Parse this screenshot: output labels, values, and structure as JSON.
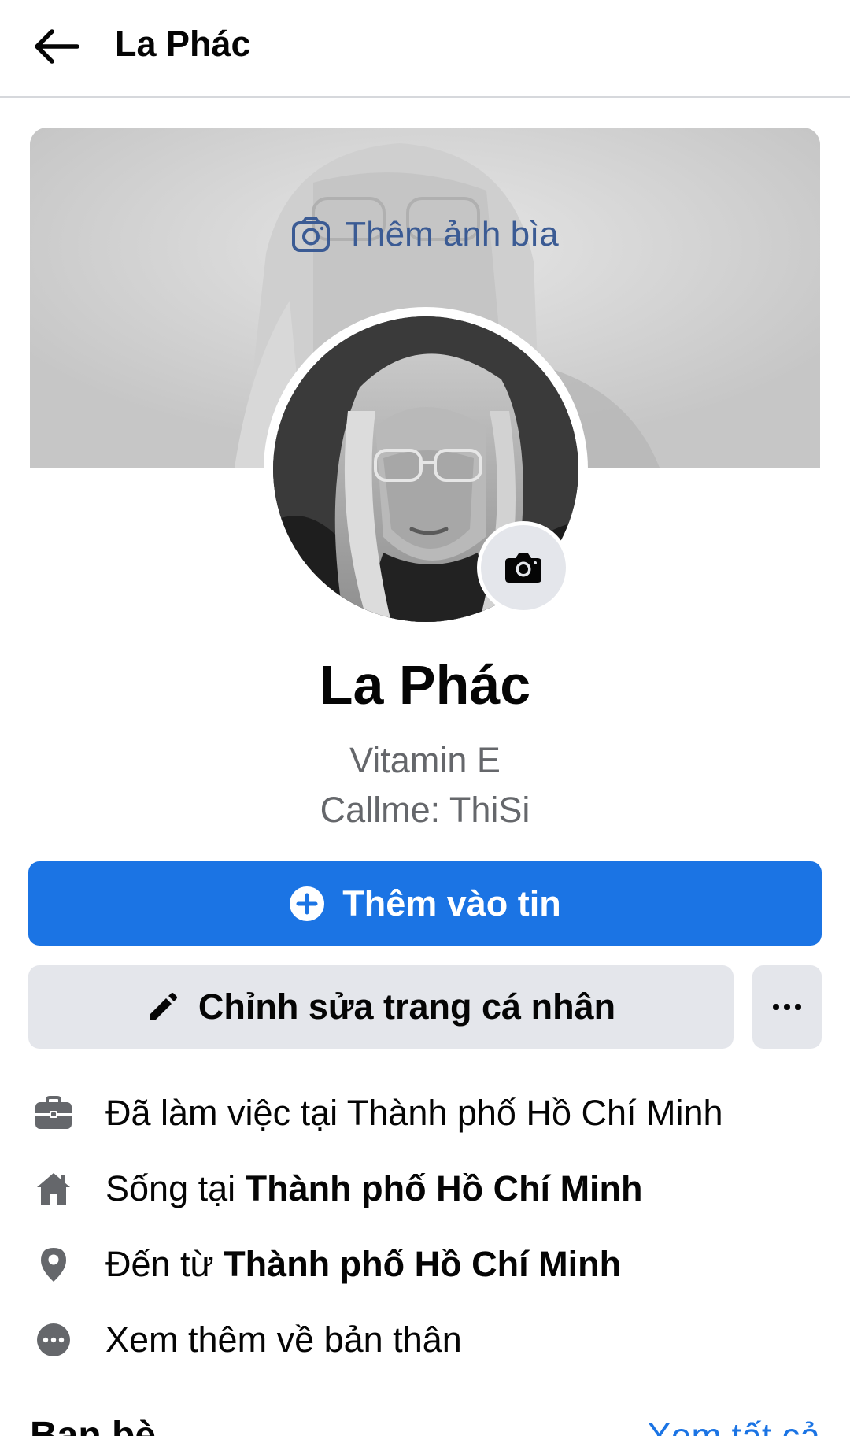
{
  "header": {
    "back_icon": "arrow-left-icon",
    "title": "La Phác"
  },
  "cover": {
    "add_cover_label": "Thêm ảnh bìa",
    "add_cover_icon": "camera-outline-icon",
    "accent": "#3b5b94"
  },
  "avatar": {
    "camera_icon": "camera-icon"
  },
  "profile": {
    "name": "La Phác",
    "bio_line1": "Vitamin E",
    "bio_line2": "Callme: ThiSi"
  },
  "actions": {
    "add_story_label": "Thêm vào tin",
    "add_story_icon": "plus-circle-icon",
    "edit_profile_label": "Chỉnh sửa trang cá nhân",
    "edit_profile_icon": "pencil-icon",
    "more_icon": "more-dots-icon",
    "primary_color": "#1b74e4",
    "secondary_color": "#e4e6eb"
  },
  "details": {
    "work": {
      "icon": "briefcase-icon",
      "text": "Đã làm việc tại Thành phố Hồ Chí Minh"
    },
    "lives": {
      "icon": "home-icon",
      "prefix": "Sống tại ",
      "place": "Thành phố Hồ Chí Minh"
    },
    "from": {
      "icon": "location-pin-icon",
      "prefix": "Đến từ ",
      "place": "Thành phố Hồ Chí Minh"
    },
    "more": {
      "icon": "more-circle-icon",
      "text": "Xem thêm về bản thân"
    }
  },
  "friends": {
    "title": "Bạn bè",
    "see_all": "Xem tất cả"
  }
}
